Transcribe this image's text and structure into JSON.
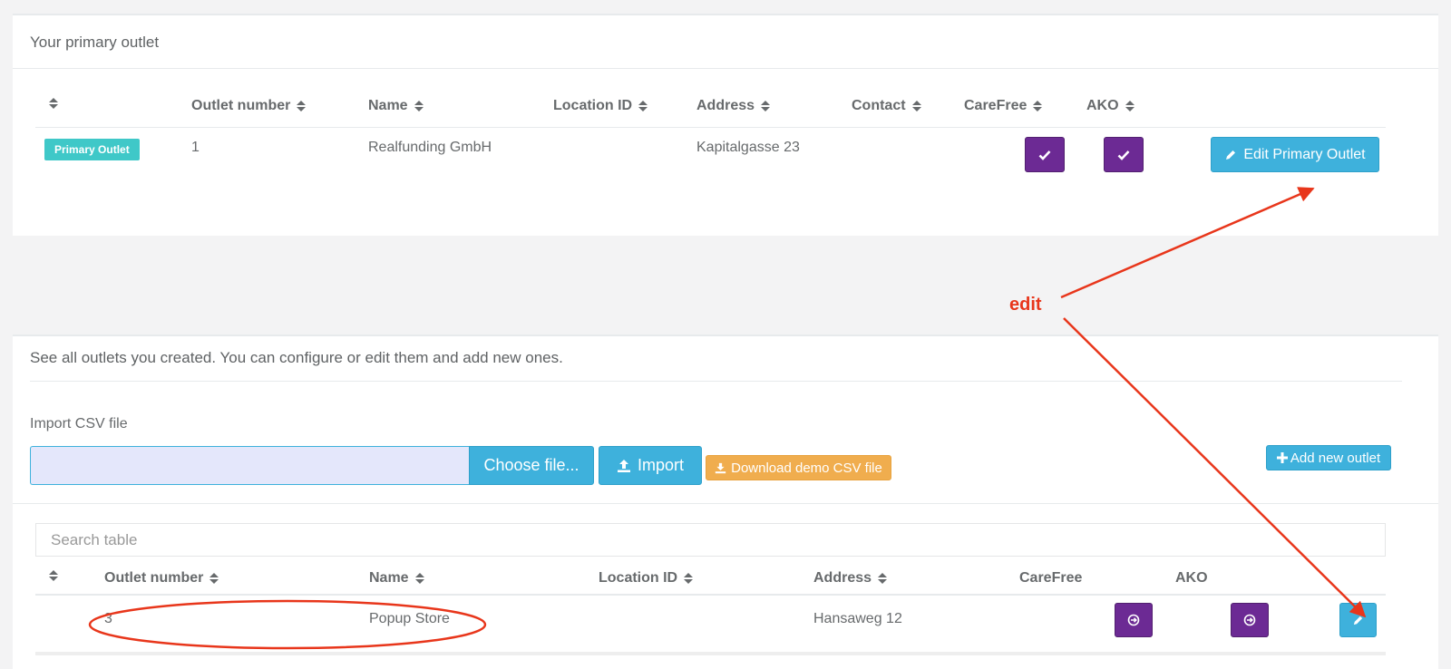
{
  "primary_panel": {
    "title": "Your primary outlet",
    "headers": [
      "Outlet number",
      "Name",
      "Location ID",
      "Address",
      "Contact",
      "CareFree",
      "AKO"
    ],
    "row": {
      "badge": "Primary Outlet",
      "outlet_number": "1",
      "name": "Realfunding GmbH",
      "location_id": "",
      "address": "Kapitalgasse 23",
      "contact": ""
    },
    "edit_button_label": "Edit Primary Outlet"
  },
  "outlets_panel": {
    "title": "See all outlets you created. You can configure or edit them and add new ones.",
    "import_label": "Import CSV file",
    "choose_file_label": "Choose file...",
    "import_button_label": "Import",
    "download_demo_label": "Download demo CSV file",
    "add_outlet_label": "Add new outlet",
    "search_placeholder": "Search table",
    "headers": [
      "Outlet number",
      "Name",
      "Location ID",
      "Address",
      "CareFree",
      "AKO"
    ],
    "rows": [
      {
        "outlet_number": "3",
        "name": "Popup Store",
        "location_id": "",
        "address": "Hansaweg 12"
      }
    ]
  },
  "annotation": {
    "text": "edit",
    "color": "#e8361b"
  },
  "colors": {
    "purple": "#6c2a94",
    "blue": "#3eb1dc",
    "teal": "#3fc8c8",
    "orange": "#f0ad4e"
  },
  "icons": [
    "sort-icon",
    "check-icon",
    "pencil-icon",
    "upload-icon",
    "download-icon",
    "plus-icon",
    "circle-arrow-right-icon"
  ]
}
